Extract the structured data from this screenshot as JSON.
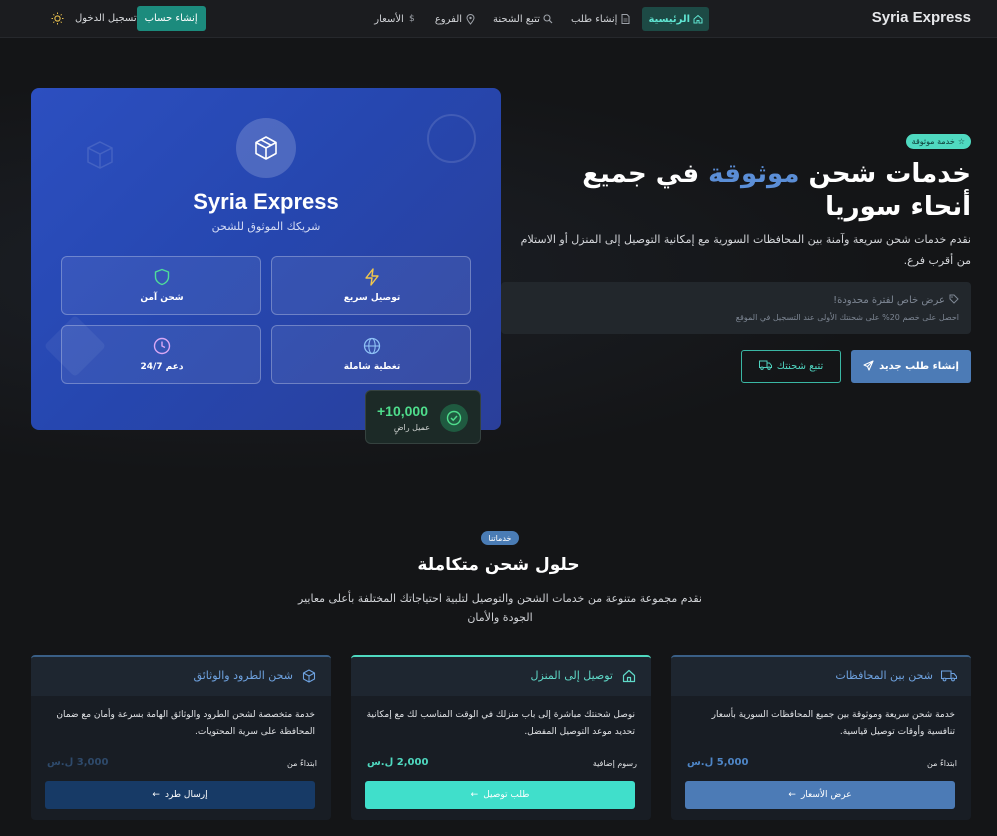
{
  "nav": {
    "brand": "Syria Express",
    "links": [
      {
        "label": "الرئيسية",
        "icon": "home-icon",
        "active": true
      },
      {
        "label": "إنشاء طلب",
        "icon": "document-icon"
      },
      {
        "label": "تتبع الشحنة",
        "icon": "search-icon"
      },
      {
        "label": "الفروع",
        "icon": "location-pin-icon"
      },
      {
        "label": "الأسعار",
        "icon": "dollar-icon"
      }
    ],
    "login_label": "تسجيل الدخول",
    "signup_label": "إنشاء حساب",
    "theme_icon": "sun-icon"
  },
  "hero": {
    "tag": "خدمة موثوقة",
    "title_pre": "خدمات شحن ",
    "title_highlight": "موثوقة",
    "title_post": " في جميع أنحاء سوريا",
    "description": "نقدم خدمات شحن سريعة وآمنة بين المحافظات السورية مع إمكانية التوصيل إلى المنزل أو الاستلام من أقرب فرع.",
    "offer_title": "عرض خاص لفترة محدودة!",
    "offer_text": "احصل على خصم 20% على شحنتك الأولى عند التسجيل في الموقع",
    "primary_button": "إنشاء طلب جديد",
    "secondary_button": "تتبع شحنتك",
    "highlight_color": "#5b8ed6"
  },
  "card": {
    "title": "Syria Express",
    "subtitle": "شريكك الموثوق للشحن",
    "features": [
      {
        "label": "توصيل سريع",
        "icon": "lightning-icon"
      },
      {
        "label": "شحن آمن",
        "icon": "shield-icon"
      },
      {
        "label": "تغطية شاملة",
        "icon": "globe-icon"
      },
      {
        "label": "دعم 24/7",
        "icon": "clock-icon"
      }
    ],
    "stat_value": "+10,000",
    "stat_label": "عميل راضٍ"
  },
  "services": {
    "tag": "خدماتنا",
    "title": "حلول شحن متكاملة",
    "description": "نقدم مجموعة متنوعة من خدمات الشحن والتوصيل لتلبية احتياجاتك المختلفة بأعلى معايير الجودة والأمان",
    "cards": [
      {
        "title": "شحن بين المحافظات",
        "icon": "truck-icon",
        "text": "خدمة شحن سريعة وموثوقة بين جميع المحافظات السورية بأسعار تنافسية وأوقات توصيل قياسية.",
        "price_label": "ابتداءً من",
        "price": "5,000 ل.س",
        "button": "عرض الأسعار"
      },
      {
        "title": "توصيل إلى المنزل",
        "icon": "house-icon",
        "text": "نوصل شحنتك مباشرة إلى باب منزلك في الوقت المناسب لك مع إمكانية تحديد موعد التوصيل المفضل.",
        "price_label": "رسوم إضافية",
        "price": "2,000 ل.س",
        "button": "طلب توصيل"
      },
      {
        "title": "شحن الطرود والوثائق",
        "icon": "box-icon",
        "text": "خدمة متخصصة لشحن الطرود والوثائق الهامة بسرعة وأمان مع ضمان المحافظة على سرية المحتويات.",
        "price_label": "ابتداءً من",
        "price": "3,000 ل.س",
        "button": "إرسال طرد"
      }
    ]
  }
}
